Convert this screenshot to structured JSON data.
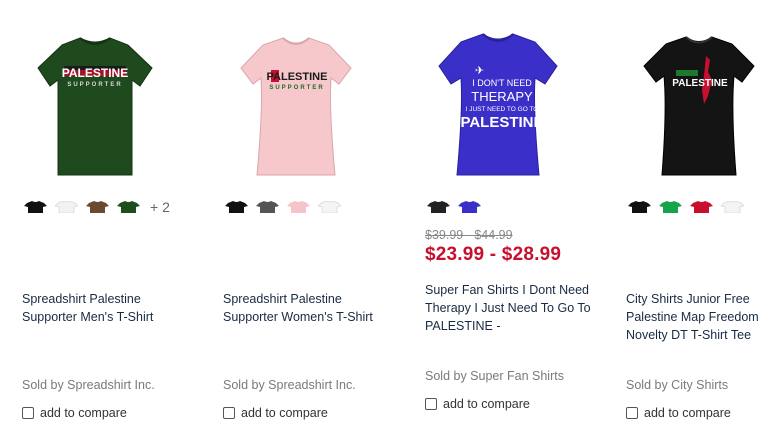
{
  "products": [
    {
      "shirt_text": "PALESTINE",
      "shirt_subtext": "SUPPORTER",
      "swatches": [
        "#111111",
        "#f2f2f2",
        "#6b4a2e",
        "#1e4d1e"
      ],
      "more_colors": "+ 2",
      "title": "Spreadshirt Palestine Supporter Men's T-Shirt",
      "seller": "Sold by Spreadshirt Inc.",
      "compare_label": "add to compare"
    },
    {
      "shirt_text": "PALESTINE",
      "shirt_subtext": "SUPPORTER",
      "swatches": [
        "#111111",
        "#555555",
        "#f4c4c8",
        "#f4f4f4"
      ],
      "title": "Spreadshirt Palestine Supporter Women's T-Shirt",
      "seller": "Sold by Spreadshirt Inc.",
      "compare_label": "add to compare"
    },
    {
      "shirt_lines": [
        "I DON'T NEED",
        "THERAPY",
        "I JUST NEED TO GO TO",
        "PALESTINE"
      ],
      "swatches": [
        "#222222",
        "#3b2fc9"
      ],
      "old_price": "$39.99 - $44.99",
      "price": "$23.99 - $28.99",
      "title": "Super Fan Shirts I Dont Need Therapy I Just Need To Go To PALESTINE -",
      "seller": "Sold by Super Fan Shirts",
      "compare_label": "add to compare"
    },
    {
      "shirt_text": "PALESTINE",
      "swatches": [
        "#111111",
        "#16a34a",
        "#c8102e",
        "#f4f4f4"
      ],
      "title": "City Shirts Junior Free Palestine Map Freedom Novelty DT T-Shirt Tee",
      "seller": "Sold by City Shirts",
      "compare_label": "add to compare"
    }
  ]
}
